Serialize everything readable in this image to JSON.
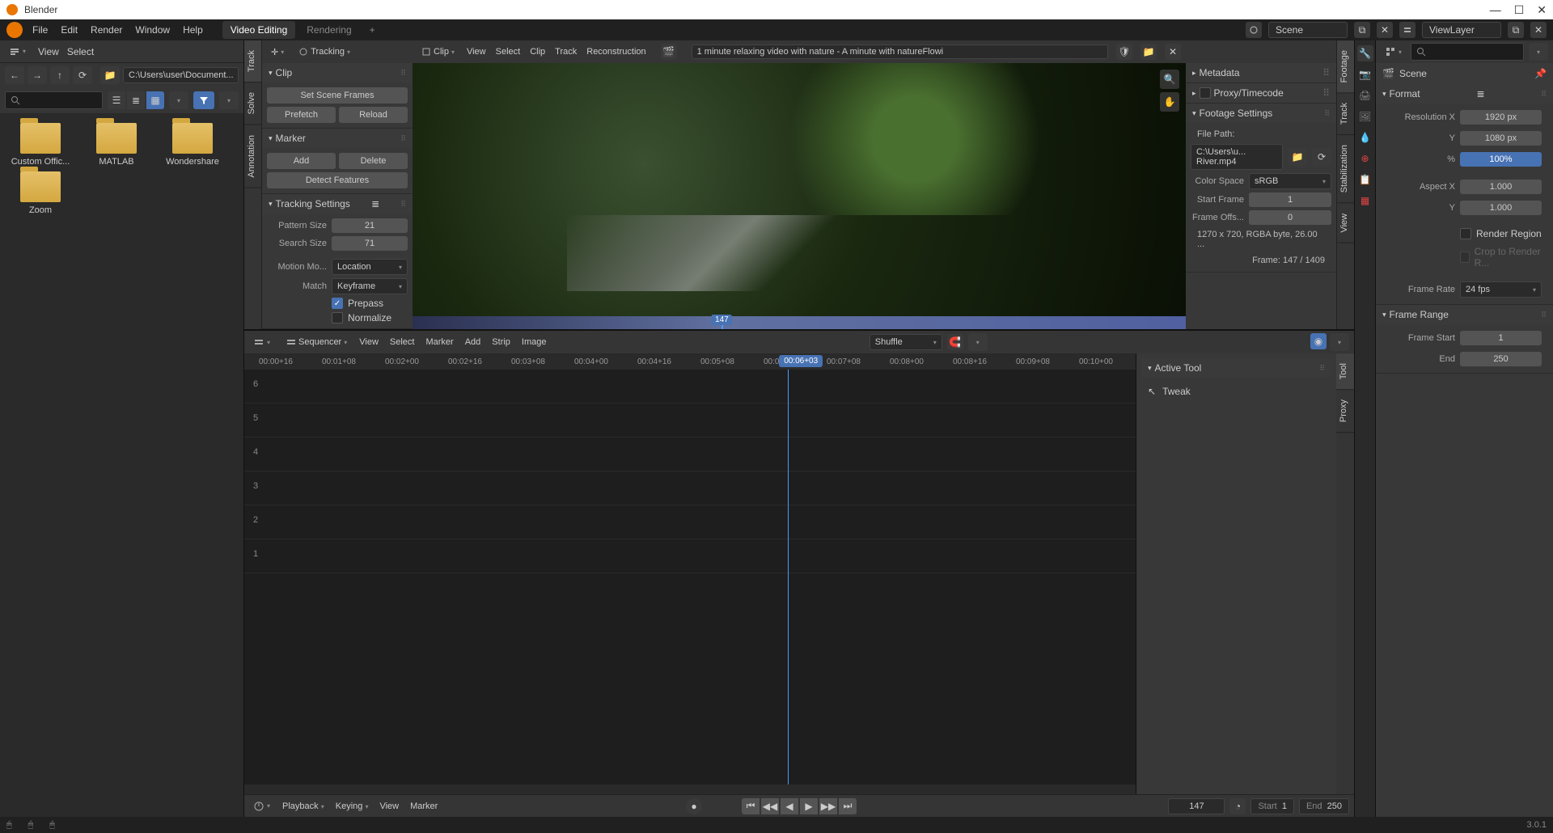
{
  "titlebar": {
    "title": "Blender"
  },
  "menubar": {
    "items": [
      "File",
      "Edit",
      "Render",
      "Window",
      "Help"
    ],
    "workspaces": {
      "active": "Video Editing",
      "inactive": "Rendering"
    },
    "scene_label": "Scene",
    "viewlayer_label": "ViewLayer"
  },
  "filebrowser": {
    "toolbar": [
      "View",
      "Select"
    ],
    "path": "C:\\Users\\user\\Document...",
    "folders": [
      {
        "name": "Custom Offic..."
      },
      {
        "name": "MATLAB"
      },
      {
        "name": "Wondershare"
      },
      {
        "name": "Zoom"
      }
    ]
  },
  "tracking": {
    "header": {
      "cursor": "",
      "mode": "Tracking",
      "clip": "Clip"
    },
    "left_tabs": [
      "Track",
      "Solve",
      "Annotation"
    ],
    "clip_panel": {
      "title": "Clip",
      "set_scene_frames": "Set Scene Frames",
      "prefetch": "Prefetch",
      "reload": "Reload"
    },
    "marker_panel": {
      "title": "Marker",
      "add": "Add",
      "delete": "Delete",
      "detect": "Detect Features"
    },
    "tracking_settings": {
      "title": "Tracking Settings",
      "pattern_size_label": "Pattern Size",
      "pattern_size": "21",
      "search_size_label": "Search Size",
      "search_size": "71",
      "motion_model_label": "Motion Mo...",
      "motion_model": "Location",
      "match_label": "Match",
      "match": "Keyframe",
      "prepass": "Prepass",
      "normalize": "Normalize"
    },
    "viewport": {
      "menus": [
        "View",
        "Select",
        "Clip",
        "Track",
        "Reconstruction"
      ],
      "clip_name": "1 minute relaxing video with nature - A minute with natureFlowi",
      "playhead_frame": "147"
    },
    "right_panels": {
      "metadata": "Metadata",
      "proxy": "Proxy/Timecode",
      "footage": {
        "title": "Footage Settings",
        "file_path_label": "File Path:",
        "file_path": "C:\\Users\\u... River.mp4",
        "color_space_label": "Color Space",
        "color_space": "sRGB",
        "start_frame_label": "Start Frame",
        "start_frame": "1",
        "frame_offset_label": "Frame Offs...",
        "frame_offset": "0",
        "info1": "1270 x 720, RGBA byte, 26.00 ...",
        "info2": "Frame: 147 / 1409"
      }
    },
    "right_tabs": [
      "Footage",
      "Track",
      "Stabilization",
      "View"
    ]
  },
  "properties": {
    "scene_label": "Scene",
    "format": {
      "title": "Format",
      "res_x_label": "Resolution X",
      "res_x": "1920 px",
      "res_y_label": "Y",
      "res_y": "1080 px",
      "pct_label": "%",
      "pct": "100%",
      "aspect_x_label": "Aspect X",
      "aspect_x": "1.000",
      "aspect_y_label": "Y",
      "aspect_y": "1.000",
      "render_region": "Render Region",
      "crop": "Crop to Render R...",
      "frame_rate_label": "Frame Rate",
      "frame_rate": "24 fps"
    },
    "frame_range": {
      "title": "Frame Range",
      "start_label": "Frame Start",
      "start": "1",
      "end_label": "End",
      "end": "250"
    }
  },
  "sequencer": {
    "header": {
      "type": "Sequencer",
      "menus": [
        "View",
        "Select",
        "Marker",
        "Add",
        "Strip",
        "Image"
      ],
      "shuffle": "Shuffle"
    },
    "ruler": [
      "00:00+16",
      "00:01+08",
      "00:02+00",
      "00:02+16",
      "00:03+08",
      "00:04+00",
      "00:04+16",
      "00:05+08",
      "00:06+03",
      "00:06+16",
      "00:07+08",
      "00:08+00",
      "00:08+16",
      "00:09+08",
      "00:10+00"
    ],
    "ruler_playhead": "00:06+03",
    "channels": [
      "6",
      "5",
      "4",
      "3",
      "2",
      "1"
    ],
    "right": {
      "tabs": [
        "Tool",
        "Proxy"
      ],
      "active_tool_title": "Active Tool",
      "tweak": "Tweak"
    },
    "footer": {
      "menus": [
        "Playback",
        "Keying",
        "View",
        "Marker"
      ],
      "current": "147",
      "start_label": "Start",
      "start": "1",
      "end_label": "End",
      "end": "250"
    }
  },
  "statusbar": {
    "version": "3.0.1"
  }
}
